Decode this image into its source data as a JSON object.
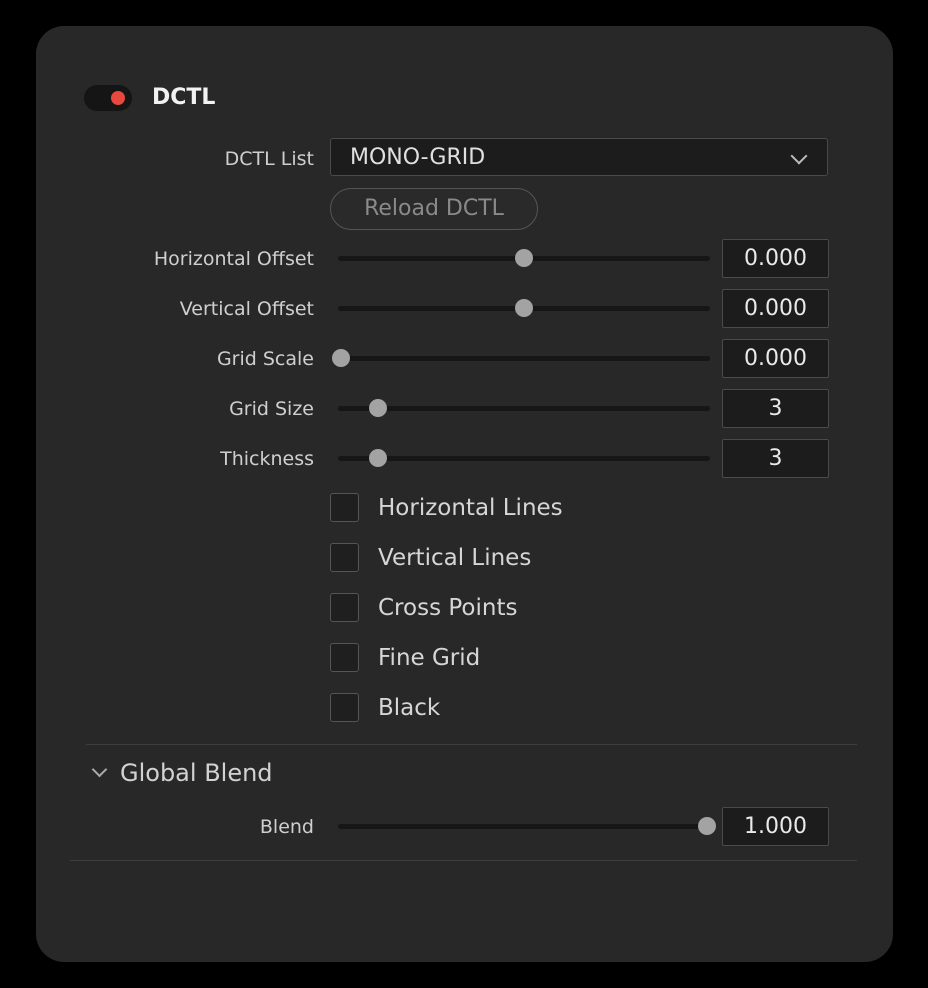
{
  "header": {
    "title": "DCTL",
    "enabled": true,
    "toggle_color": "#e8483e"
  },
  "dctl_list": {
    "label": "DCTL List",
    "selected": "MONO-GRID"
  },
  "reload_button": {
    "label": "Reload DCTL"
  },
  "sliders": [
    {
      "label": "Horizontal Offset",
      "value": "0.000",
      "fraction": 0.5
    },
    {
      "label": "Vertical Offset",
      "value": "0.000",
      "fraction": 0.5
    },
    {
      "label": "Grid Scale",
      "value": "0.000",
      "fraction": 0.0
    },
    {
      "label": "Grid Size",
      "value": "3",
      "fraction": 0.1
    },
    {
      "label": "Thickness",
      "value": "3",
      "fraction": 0.1
    }
  ],
  "checkboxes": [
    {
      "label": "Horizontal Lines",
      "checked": false
    },
    {
      "label": "Vertical Lines",
      "checked": false
    },
    {
      "label": "Cross Points",
      "checked": false
    },
    {
      "label": "Fine Grid",
      "checked": false
    },
    {
      "label": "Black",
      "checked": false
    }
  ],
  "global_blend": {
    "title": "Global Blend",
    "expanded": true,
    "blend": {
      "label": "Blend",
      "value": "1.000",
      "fraction": 1.0
    }
  }
}
